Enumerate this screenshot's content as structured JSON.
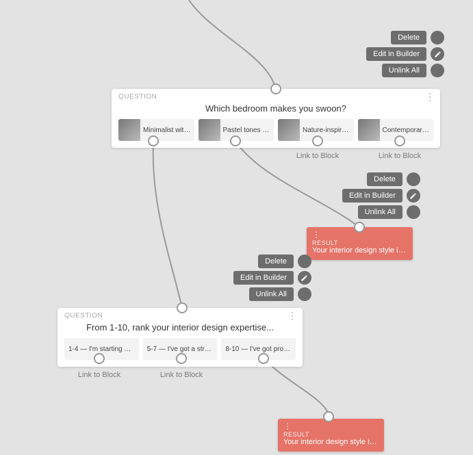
{
  "actions": {
    "delete": "Delete",
    "edit": "Edit in Builder",
    "unlink": "Unlink All"
  },
  "link_label": "Link to Block",
  "question1": {
    "type": "QUESTION",
    "title": "Which bedroom makes you swoon?",
    "answers": [
      {
        "label": "Minimalist with ..."
      },
      {
        "label": "Pastel tones an..."
      },
      {
        "label": "Nature-inspired..."
      },
      {
        "label": "Contemporary ..."
      }
    ]
  },
  "question2": {
    "type": "QUESTION",
    "title": "From 1-10, rank your interior design expertise...",
    "answers": [
      {
        "label": "1-4 — I'm starting with ..."
      },
      {
        "label": "5-7 — I've got a strong ..."
      },
      {
        "label": "8-10 — I've got professi..."
      }
    ]
  },
  "result1": {
    "type": "RESULT",
    "title": "Your interior design style is:..."
  },
  "result2": {
    "type": "RESULT",
    "title": "Your interior design style is:..."
  }
}
